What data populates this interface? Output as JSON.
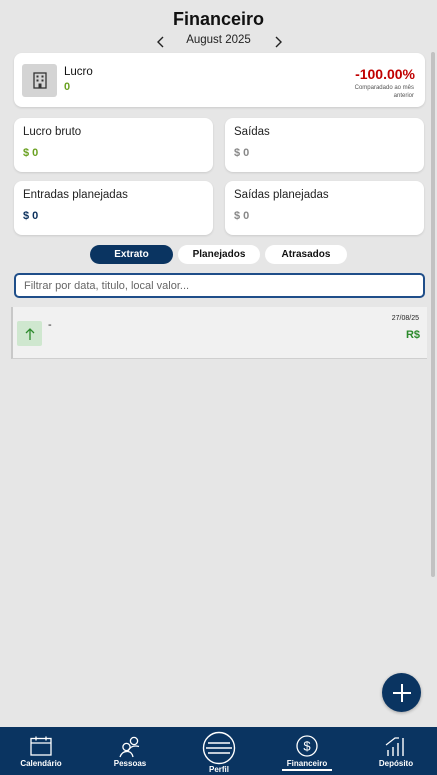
{
  "header": {
    "title": "Financeiro",
    "month": "August 2025",
    "prev_icon": "chevron-left-icon",
    "next_icon": "chevron-right-icon"
  },
  "profit_card": {
    "icon": "building-icon",
    "label": "Lucro",
    "value": "0",
    "percent": "-100.00%",
    "comparison": "Comparadado ao mês anterior"
  },
  "stats": [
    {
      "label": "Lucro bruto",
      "value": "$ 0",
      "color": "#6aa121"
    },
    {
      "label": "Saídas",
      "value": "$ 0",
      "color": "#888888"
    },
    {
      "label": "Entradas planejadas",
      "value": "$ 0",
      "color": "#0a2f5c"
    },
    {
      "label": "Saídas planejadas",
      "value": "$ 0",
      "color": "#888888"
    }
  ],
  "tabs": [
    {
      "label": "Extrato",
      "active": true
    },
    {
      "label": "Planejados",
      "active": false
    },
    {
      "label": "Atrasados",
      "active": false
    }
  ],
  "search": {
    "placeholder": "Filtrar por data, titulo, local valor...",
    "value": ""
  },
  "entries": [
    {
      "title": "-",
      "date": "27/08/25",
      "value": "R$",
      "icon": "arrow-up-icon",
      "value_color": "#2c8a2c"
    }
  ],
  "fab": {
    "icon": "plus-icon"
  },
  "bottom_nav": [
    {
      "label": "Calendário",
      "icon": "calendar-icon"
    },
    {
      "label": "Pessoas",
      "icon": "people-icon"
    },
    {
      "label": "Perfil",
      "icon": "menu-icon"
    },
    {
      "label": "Financeiro",
      "icon": "dollar-icon",
      "active": true
    },
    {
      "label": "Depósito",
      "icon": "bar-chart-icon"
    }
  ],
  "colors": {
    "primary": "#0a3461",
    "positive": "#6aa121",
    "negative": "#c00000",
    "background": "#e6e6e6"
  }
}
